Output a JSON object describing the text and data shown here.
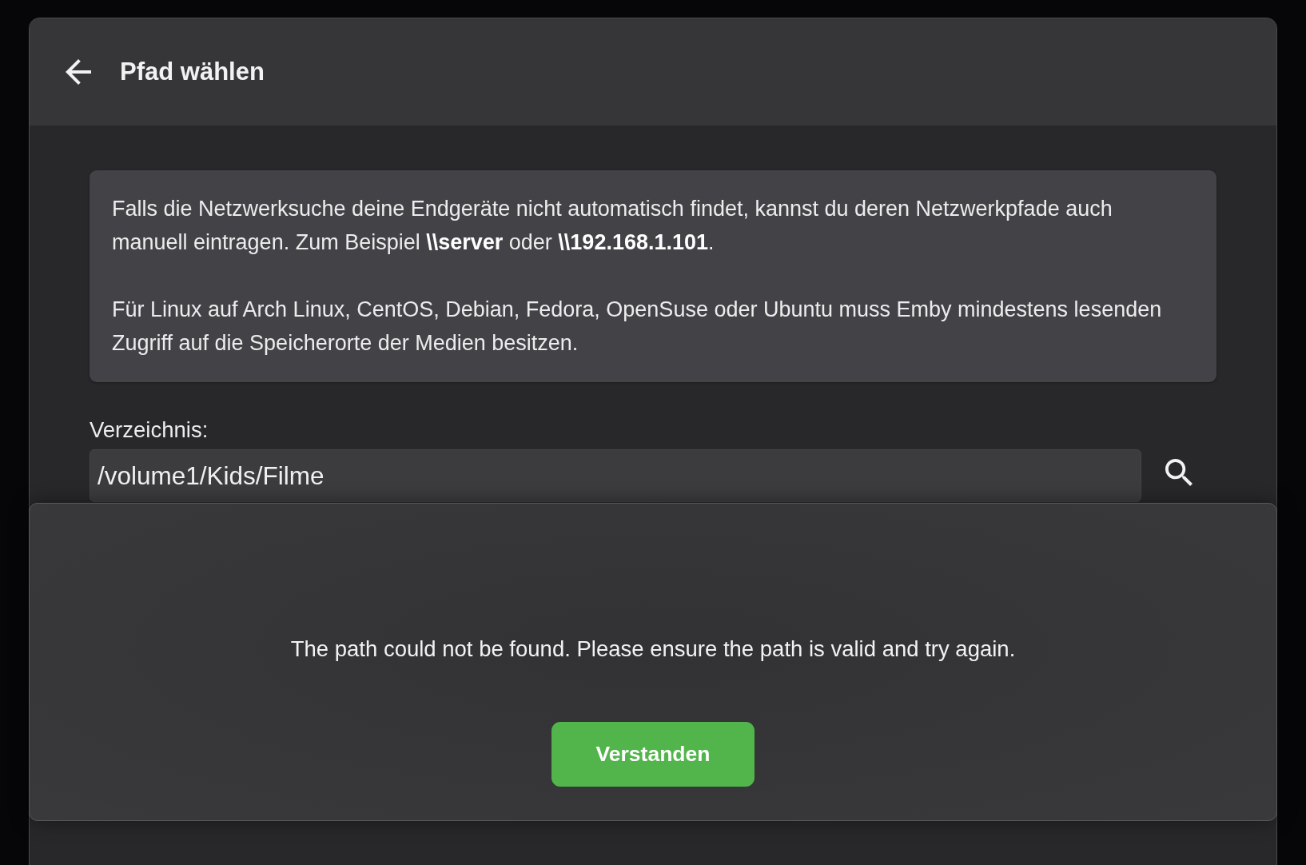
{
  "header": {
    "title": "Pfad wählen"
  },
  "info": {
    "paragraphs": [
      "Falls die Netzwerksuche deine Endgeräte nicht automatisch findet, kannst du deren Netzwerkpfade auch manuell eintragen. Zum Beispiel **\\\\server** oder **\\\\192.168.1.101**.",
      "Für Linux auf Arch Linux, CentOS, Debian, Fedora, OpenSuse oder Ubuntu muss Emby mindestens lesenden Zugriff auf die Speicherorte der Medien besitzen."
    ]
  },
  "directory": {
    "label": "Verzeichnis:",
    "value": "/volume1/Kids/Filme"
  },
  "alert": {
    "message": "The path could not be found. Please ensure the path is valid and try again.",
    "buttons": [
      "Verstanden"
    ]
  }
}
